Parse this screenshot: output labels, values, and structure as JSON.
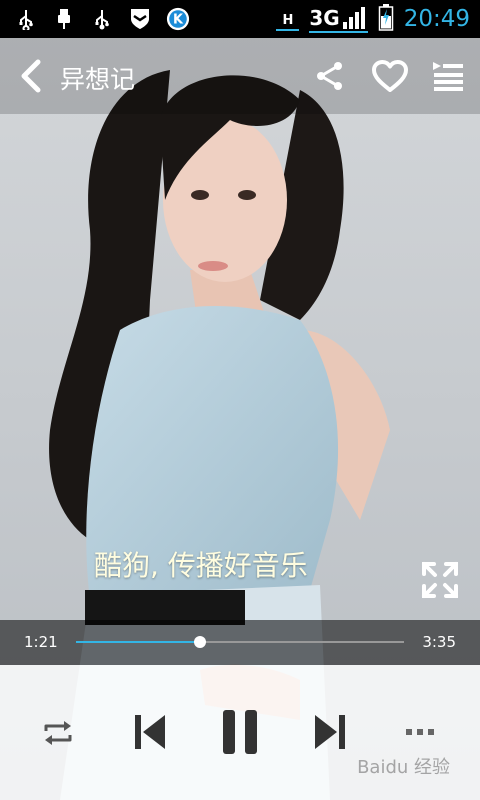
{
  "status_bar": {
    "network_h": "H",
    "network_3g": "3G",
    "time": "20:49",
    "icons": [
      "usb-icon",
      "usb-debug-icon",
      "usb-icon",
      "shield-icon",
      "kugou-k-icon"
    ]
  },
  "header": {
    "title": "异想记",
    "icons": [
      "back-icon",
      "share-icon",
      "heart-icon",
      "playlist-icon"
    ]
  },
  "lyrics": {
    "current_line": "酷狗, 传播好音乐"
  },
  "progress": {
    "elapsed": "1:21",
    "total": "3:35",
    "fraction": 0.377
  },
  "controls": {
    "icons": [
      "repeat-icon",
      "previous-icon",
      "pause-icon",
      "next-icon",
      "more-icon"
    ]
  },
  "watermark": "Baidu 经验",
  "colors": {
    "accent": "#33b5e5",
    "lyric": "#fffde0",
    "background": "#c9ced2"
  }
}
